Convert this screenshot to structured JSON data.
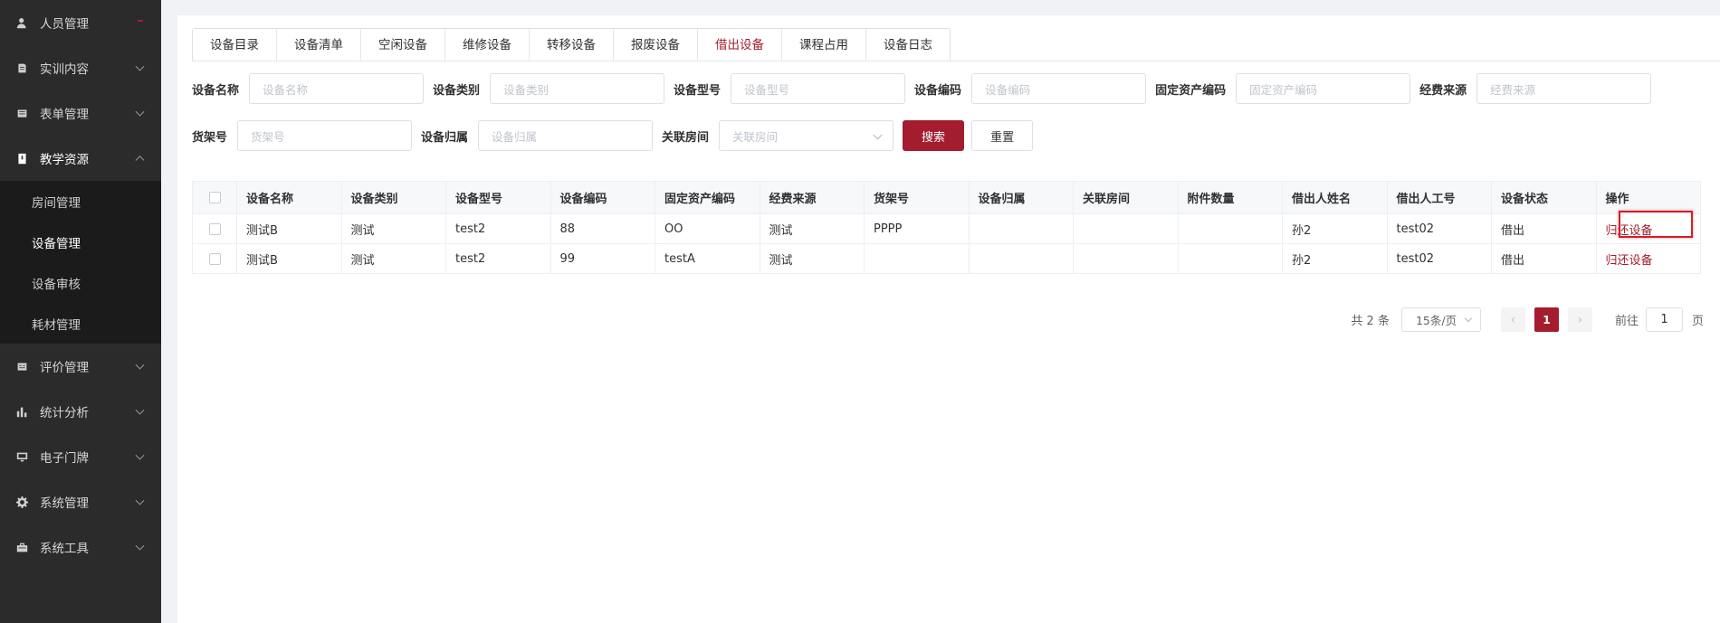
{
  "sidebar": {
    "menus": [
      {
        "label": "人员管理",
        "icon": "user-icon"
      },
      {
        "label": "实训内容",
        "icon": "book-icon"
      },
      {
        "label": "表单管理",
        "icon": "form-icon"
      },
      {
        "label": "教学资源",
        "icon": "resource-icon"
      },
      {
        "label": "评价管理",
        "icon": "evaluate-icon"
      },
      {
        "label": "统计分析",
        "icon": "bar-chart-icon"
      },
      {
        "label": "电子门牌",
        "icon": "monitor-icon"
      },
      {
        "label": "系统管理",
        "icon": "gear-icon"
      },
      {
        "label": "系统工具",
        "icon": "toolbox-icon"
      }
    ],
    "submenu": [
      "房间管理",
      "设备管理",
      "设备审核",
      "耗材管理"
    ],
    "active_sub": "设备管理",
    "accent": "#a31d2e"
  },
  "tabs": [
    "设备目录",
    "设备清单",
    "空闲设备",
    "维修设备",
    "转移设备",
    "报废设备",
    "借出设备",
    "课程占用",
    "设备日志"
  ],
  "active_tab": "借出设备",
  "filters": {
    "row1": [
      {
        "label": "设备名称",
        "placeholder": "设备名称"
      },
      {
        "label": "设备类别",
        "placeholder": "设备类别"
      },
      {
        "label": "设备型号",
        "placeholder": "设备型号"
      },
      {
        "label": "设备编码",
        "placeholder": "设备编码"
      },
      {
        "label": "固定资产编码",
        "placeholder": "固定资产编码"
      },
      {
        "label": "经费来源",
        "placeholder": "经费来源"
      }
    ],
    "row2": [
      {
        "label": "货架号",
        "placeholder": "货架号"
      },
      {
        "label": "设备归属",
        "placeholder": "设备归属"
      },
      {
        "label": "关联房间",
        "placeholder": "关联房间"
      }
    ],
    "search_button": "搜索",
    "reset_button": "重置"
  },
  "table": {
    "headers": [
      "设备名称",
      "设备类别",
      "设备型号",
      "设备编码",
      "固定资产编码",
      "经费来源",
      "货架号",
      "设备归属",
      "关联房间",
      "附件数量",
      "借出人姓名",
      "借出人工号",
      "设备状态",
      "操作"
    ],
    "rows": [
      [
        "测试B",
        "测试",
        "test2",
        "88",
        "OO",
        "测试",
        "PPPP",
        "",
        "",
        "",
        "孙2",
        "test02",
        "借出",
        "归还设备"
      ],
      [
        "测试B",
        "测试",
        "test2",
        "99",
        "testA",
        "测试",
        "",
        "",
        "",
        "",
        "孙2",
        "test02",
        "借出",
        "归还设备"
      ]
    ]
  },
  "pagination": {
    "total": "共 2 条",
    "page_size": "15条/页",
    "current_page": "1",
    "goto_label": "前往",
    "goto_value": "1",
    "page_suffix": "页"
  }
}
